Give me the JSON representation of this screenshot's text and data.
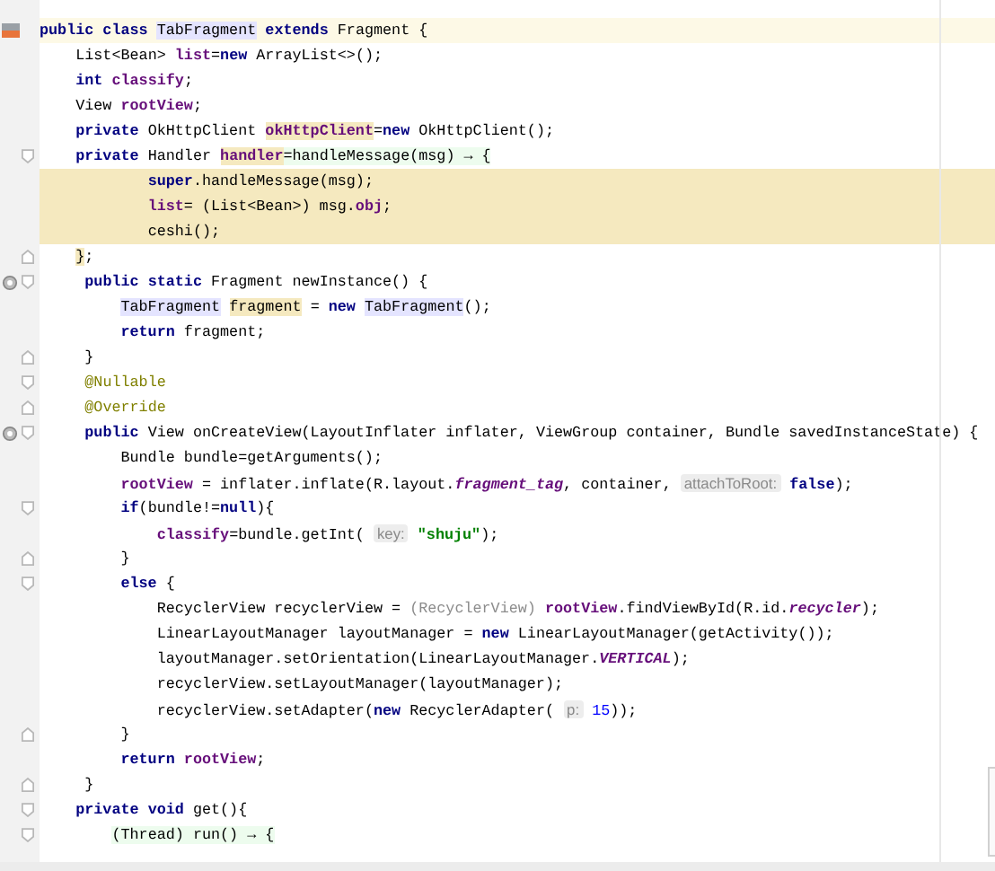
{
  "editor": {
    "lines": [
      {
        "current": true,
        "class_marker": true,
        "tokens": [
          {
            "text": "public class ",
            "kind": "keyword"
          },
          {
            "text": "TabFragment",
            "kind": "plain",
            "type_highlight": true
          },
          {
            "text": " extends",
            "kind": "keyword"
          },
          {
            "text": " Fragment {",
            "kind": "plain"
          }
        ]
      },
      {
        "tokens": [
          {
            "text": "    List<Bean> ",
            "kind": "plain"
          },
          {
            "text": "list",
            "kind": "field"
          },
          {
            "text": "=",
            "kind": "plain"
          },
          {
            "text": "new",
            "kind": "keyword"
          },
          {
            "text": " ArrayList<>();",
            "kind": "plain"
          }
        ]
      },
      {
        "tokens": [
          {
            "text": "    int ",
            "kind": "keyword"
          },
          {
            "text": "classify",
            "kind": "field"
          },
          {
            "text": ";",
            "kind": "plain"
          }
        ]
      },
      {
        "tokens": [
          {
            "text": "    View ",
            "kind": "plain"
          },
          {
            "text": "rootView",
            "kind": "field"
          },
          {
            "text": ";",
            "kind": "plain"
          }
        ]
      },
      {
        "tokens": [
          {
            "text": "    private",
            "kind": "keyword"
          },
          {
            "text": " OkHttpClient ",
            "kind": "plain"
          },
          {
            "text": "okHttpClient",
            "kind": "field",
            "usage_highlight": true
          },
          {
            "text": "=",
            "kind": "plain"
          },
          {
            "text": "new",
            "kind": "keyword"
          },
          {
            "text": " OkHttpClient();",
            "kind": "plain"
          }
        ]
      },
      {
        "fold_start": true,
        "tokens": [
          {
            "text": "    private",
            "kind": "keyword"
          },
          {
            "text": " Handler ",
            "kind": "plain"
          },
          {
            "text": "handler",
            "kind": "field",
            "usage_highlight": true
          },
          {
            "text": "=handleMessage(msg) → {",
            "kind": "plain",
            "lambda_highlight": true
          }
        ]
      },
      {
        "usage_highlight": true,
        "tokens": [
          {
            "text": "            super",
            "kind": "keyword"
          },
          {
            "text": ".handleMessage(msg);",
            "kind": "plain"
          }
        ]
      },
      {
        "usage_highlight": true,
        "tokens": [
          {
            "text": "            list",
            "kind": "field"
          },
          {
            "text": "= (List<Bean>) msg.",
            "kind": "plain"
          },
          {
            "text": "obj",
            "kind": "field"
          },
          {
            "text": ";",
            "kind": "plain"
          }
        ]
      },
      {
        "usage_highlight": true,
        "tokens": [
          {
            "text": "            ceshi();",
            "kind": "plain"
          }
        ]
      },
      {
        "fold_end": true,
        "tokens": [
          {
            "text": "    }",
            "kind": "plain",
            "usage_highlight": true
          },
          {
            "text": ";",
            "kind": "plain"
          }
        ]
      },
      {
        "fold_start": true,
        "override_marker": true,
        "tokens": [
          {
            "text": "     public static",
            "kind": "keyword"
          },
          {
            "text": " Fragment newInstance() {",
            "kind": "plain"
          }
        ]
      },
      {
        "tokens": [
          {
            "text": "         TabFragment",
            "kind": "plain",
            "type_highlight": true
          },
          {
            "text": " fragment",
            "kind": "plain",
            "usage_highlight": true
          },
          {
            "text": " = ",
            "kind": "plain"
          },
          {
            "text": "new",
            "kind": "keyword"
          },
          {
            "text": " TabFragment",
            "kind": "plain",
            "type_highlight": true
          },
          {
            "text": "();",
            "kind": "plain"
          }
        ]
      },
      {
        "tokens": [
          {
            "text": "         return",
            "kind": "keyword"
          },
          {
            "text": " fragment;",
            "kind": "plain"
          }
        ]
      },
      {
        "fold_end": true,
        "tokens": [
          {
            "text": "     }",
            "kind": "plain"
          }
        ]
      },
      {
        "fold_start": true,
        "tokens": [
          {
            "text": "     @Nullable",
            "kind": "annotation"
          }
        ]
      },
      {
        "fold_end": true,
        "tokens": [
          {
            "text": "     @Override",
            "kind": "annotation"
          }
        ]
      },
      {
        "fold_start": true,
        "override_marker": true,
        "tokens": [
          {
            "text": "     public",
            "kind": "keyword"
          },
          {
            "text": " View onCreateView(LayoutInflater inflater, ViewGroup container, Bundle savedInstanceState) {",
            "kind": "plain"
          }
        ]
      },
      {
        "tokens": [
          {
            "text": "         Bundle bundle=getArguments();",
            "kind": "plain"
          }
        ]
      },
      {
        "tokens": [
          {
            "text": "         rootView",
            "kind": "field"
          },
          {
            "text": " = inflater.inflate(R.layout.",
            "kind": "plain"
          },
          {
            "text": "fragment_tag",
            "kind": "static"
          },
          {
            "text": ", container, ",
            "kind": "plain"
          },
          {
            "text": "attachToRoot:",
            "kind": "hint"
          },
          {
            "text": " false",
            "kind": "keyword"
          },
          {
            "text": ");",
            "kind": "plain"
          }
        ]
      },
      {
        "fold_start": true,
        "tokens": [
          {
            "text": "         if",
            "kind": "keyword"
          },
          {
            "text": "(bundle!=",
            "kind": "plain"
          },
          {
            "text": "null",
            "kind": "keyword"
          },
          {
            "text": "){",
            "kind": "plain"
          }
        ]
      },
      {
        "tokens": [
          {
            "text": "             classify",
            "kind": "field"
          },
          {
            "text": "=bundle.getInt( ",
            "kind": "plain"
          },
          {
            "text": "key:",
            "kind": "hint"
          },
          {
            "text": " \"shuju\"",
            "kind": "string"
          },
          {
            "text": ");",
            "kind": "plain"
          }
        ]
      },
      {
        "fold_end": true,
        "tokens": [
          {
            "text": "         }",
            "kind": "plain"
          }
        ]
      },
      {
        "fold_start": true,
        "tokens": [
          {
            "text": "         else",
            "kind": "keyword"
          },
          {
            "text": " {",
            "kind": "plain"
          }
        ]
      },
      {
        "tokens": [
          {
            "text": "             RecyclerView recyclerView = ",
            "kind": "plain"
          },
          {
            "text": "(RecyclerView)",
            "kind": "cast"
          },
          {
            "text": " rootView",
            "kind": "field"
          },
          {
            "text": ".findViewById(R.id.",
            "kind": "plain"
          },
          {
            "text": "recycler",
            "kind": "static"
          },
          {
            "text": ");",
            "kind": "plain"
          }
        ]
      },
      {
        "tokens": [
          {
            "text": "             LinearLayoutManager layoutManager = ",
            "kind": "plain"
          },
          {
            "text": "new",
            "kind": "keyword"
          },
          {
            "text": " LinearLayoutManager(getActivity());",
            "kind": "plain"
          }
        ]
      },
      {
        "tokens": [
          {
            "text": "             layoutManager.setOrientation(LinearLayoutManager.",
            "kind": "plain"
          },
          {
            "text": "VERTICAL",
            "kind": "static"
          },
          {
            "text": ");",
            "kind": "plain"
          }
        ]
      },
      {
        "tokens": [
          {
            "text": "             recyclerView.setLayoutManager(layoutManager);",
            "kind": "plain"
          }
        ]
      },
      {
        "tokens": [
          {
            "text": "             recyclerView.setAdapter(",
            "kind": "plain"
          },
          {
            "text": "new",
            "kind": "keyword"
          },
          {
            "text": " RecyclerAdapter( ",
            "kind": "plain"
          },
          {
            "text": "p:",
            "kind": "hint"
          },
          {
            "text": " 15",
            "kind": "number"
          },
          {
            "text": "));",
            "kind": "plain"
          }
        ]
      },
      {
        "fold_end": true,
        "tokens": [
          {
            "text": "         }",
            "kind": "plain"
          }
        ]
      },
      {
        "tokens": [
          {
            "text": "         return",
            "kind": "keyword"
          },
          {
            "text": " rootView",
            "kind": "field"
          },
          {
            "text": ";",
            "kind": "plain"
          }
        ]
      },
      {
        "fold_end": true,
        "tokens": [
          {
            "text": "     }",
            "kind": "plain"
          }
        ]
      },
      {
        "fold_start": true,
        "tokens": [
          {
            "text": "    private void",
            "kind": "keyword"
          },
          {
            "text": " get(){",
            "kind": "plain"
          }
        ]
      },
      {
        "fold_start": true,
        "tokens": [
          {
            "text": "        (Thread) run() → {",
            "kind": "plain",
            "lambda_highlight": true
          }
        ]
      }
    ]
  }
}
